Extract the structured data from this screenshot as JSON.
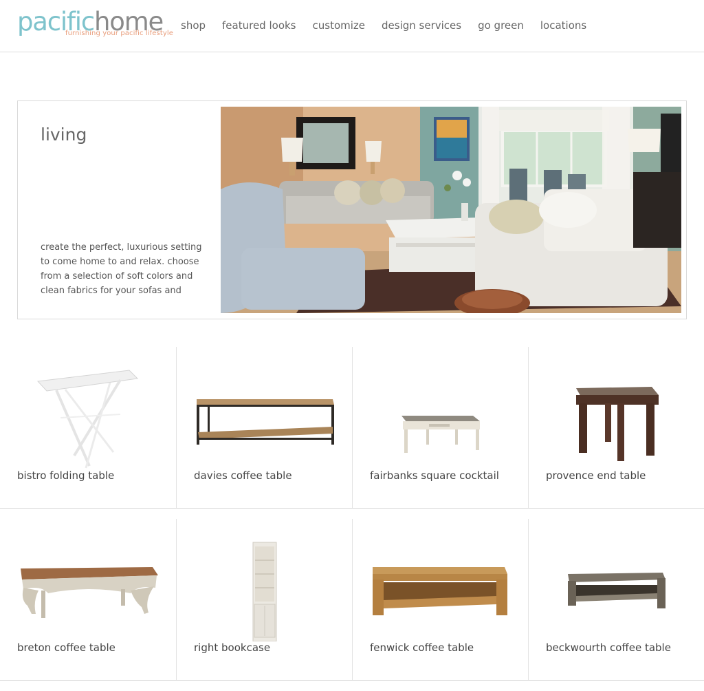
{
  "brand": {
    "word_1": "pacific",
    "word_2": "home",
    "tagline": "furnishing your pacific lifestyle",
    "color_primary": "#7ec3cc",
    "color_secondary": "#8a8a8a",
    "color_tagline": "#e89c7a"
  },
  "nav": {
    "items": [
      {
        "label": "shop"
      },
      {
        "label": "featured looks"
      },
      {
        "label": "customize"
      },
      {
        "label": "design services"
      },
      {
        "label": "go green"
      },
      {
        "label": "locations"
      }
    ]
  },
  "hero": {
    "title": "living",
    "description": "create the perfect, luxurious setting to come home to and relax. choose from a selection of soft colors and clean fabrics for your sofas and",
    "image": "living-room-photo"
  },
  "products": [
    {
      "name": "bistro folding table",
      "image": "bistro-folding-table"
    },
    {
      "name": "davies coffee table",
      "image": "davies-coffee-table"
    },
    {
      "name": "fairbanks square cocktail",
      "image": "fairbanks-square-cocktail"
    },
    {
      "name": "provence end table",
      "image": "provence-end-table"
    },
    {
      "name": "breton coffee table",
      "image": "breton-coffee-table"
    },
    {
      "name": "right bookcase",
      "image": "right-bookcase"
    },
    {
      "name": "fenwick coffee table",
      "image": "fenwick-coffee-table"
    },
    {
      "name": "beckwourth coffee table",
      "image": "beckwourth-coffee-table"
    }
  ]
}
